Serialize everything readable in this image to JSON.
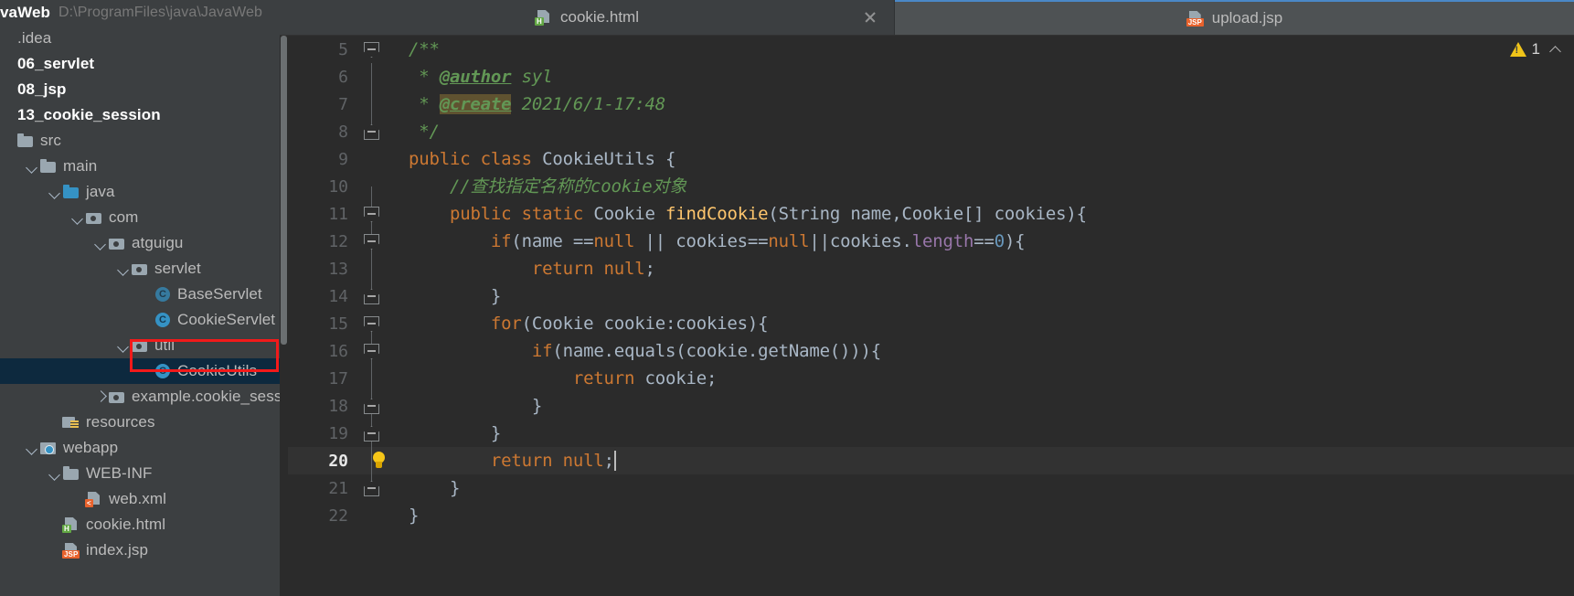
{
  "sidebar": {
    "project_header": {
      "name": "vaWeb",
      "path": "D:\\ProgramFiles\\java\\JavaWeb"
    },
    "items": [
      {
        "label": ".idea",
        "indent": 0,
        "twisty": "",
        "icon": "",
        "style": "plain",
        "selected": false
      },
      {
        "label": "06_servlet",
        "indent": 0,
        "twisty": "",
        "icon": "",
        "style": "bold",
        "selected": false
      },
      {
        "label": "08_jsp",
        "indent": 0,
        "twisty": "",
        "icon": "",
        "style": "bold",
        "selected": false
      },
      {
        "label": "13_cookie_session",
        "indent": 0,
        "twisty": "",
        "icon": "",
        "style": "bold",
        "selected": false
      },
      {
        "label": "src",
        "indent": 0,
        "twisty": "",
        "icon": "folder",
        "style": "plain",
        "selected": false
      },
      {
        "label": "main",
        "indent": 1,
        "twisty": "down",
        "icon": "folder",
        "style": "plain",
        "selected": false
      },
      {
        "label": "java",
        "indent": 2,
        "twisty": "down",
        "icon": "folder-src",
        "style": "plain",
        "selected": false
      },
      {
        "label": "com",
        "indent": 3,
        "twisty": "down",
        "icon": "pkg",
        "style": "plain",
        "selected": false
      },
      {
        "label": "atguigu",
        "indent": 4,
        "twisty": "down",
        "icon": "pkg",
        "style": "plain",
        "selected": false
      },
      {
        "label": "servlet",
        "indent": 5,
        "twisty": "down",
        "icon": "pkg",
        "style": "plain",
        "selected": false
      },
      {
        "label": "BaseServlet",
        "indent": 6,
        "twisty": "",
        "icon": "class-abs",
        "style": "plain",
        "selected": false
      },
      {
        "label": "CookieServlet",
        "indent": 6,
        "twisty": "",
        "icon": "class",
        "style": "plain",
        "selected": false
      },
      {
        "label": "util",
        "indent": 5,
        "twisty": "down",
        "icon": "pkg",
        "style": "plain",
        "selected": false
      },
      {
        "label": "CookieUtils",
        "indent": 6,
        "twisty": "",
        "icon": "class",
        "style": "plain",
        "selected": true
      },
      {
        "label": "example.cookie_session",
        "indent": 4,
        "twisty": "right",
        "icon": "pkg",
        "style": "plain",
        "selected": false
      },
      {
        "label": "resources",
        "indent": 2,
        "twisty": "",
        "icon": "res",
        "style": "plain",
        "selected": false
      },
      {
        "label": "webapp",
        "indent": 1,
        "twisty": "down",
        "icon": "web",
        "style": "plain",
        "selected": false
      },
      {
        "label": "WEB-INF",
        "indent": 2,
        "twisty": "down",
        "icon": "folder",
        "style": "plain",
        "selected": false
      },
      {
        "label": "web.xml",
        "indent": 3,
        "twisty": "",
        "icon": "file-xml",
        "style": "plain",
        "selected": false
      },
      {
        "label": "cookie.html",
        "indent": 2,
        "twisty": "",
        "icon": "file-h",
        "style": "plain",
        "selected": false
      },
      {
        "label": "index.jsp",
        "indent": 2,
        "twisty": "",
        "icon": "file-jsp",
        "style": "plain",
        "selected": false
      }
    ],
    "annotation": {
      "shape": "rectangle",
      "color": "#f21a1a",
      "targets": "CookieUtils"
    }
  },
  "editor": {
    "tabs": [
      {
        "label": "cookie.html",
        "icon": "html-file-icon",
        "active": false,
        "closable": true
      },
      {
        "label": "upload.jsp",
        "icon": "jsp-file-icon",
        "active": true,
        "closable": false
      }
    ],
    "inspection": {
      "warning_count": "1",
      "icon": "warning-triangle-icon"
    },
    "cursor_line": "20",
    "lines": [
      {
        "n": "5",
        "fold": "open",
        "foldline": "",
        "bulb": false,
        "indent_guides": [],
        "tokens": [
          {
            "t": "/**",
            "c": "doc"
          }
        ]
      },
      {
        "n": "6",
        "fold": "",
        "foldline": "full",
        "bulb": false,
        "indent_guides": [],
        "tokens": [
          {
            "t": " * ",
            "c": "doc"
          },
          {
            "t": "@author",
            "c": "tag"
          },
          {
            "t": " syl",
            "c": "doc"
          }
        ]
      },
      {
        "n": "7",
        "fold": "",
        "foldline": "full",
        "bulb": false,
        "indent_guides": [],
        "tokens": [
          {
            "t": " * ",
            "c": "doc"
          },
          {
            "t": "@create",
            "c": "tagH"
          },
          {
            "t": " 2021/6/1-17:48",
            "c": "doc"
          }
        ]
      },
      {
        "n": "8",
        "fold": "close",
        "foldline": "half-top",
        "bulb": false,
        "indent_guides": [],
        "tokens": [
          {
            "t": " */",
            "c": "doc"
          }
        ]
      },
      {
        "n": "9",
        "fold": "",
        "foldline": "",
        "bulb": false,
        "indent_guides": [],
        "tokens": [
          {
            "t": "public class ",
            "c": "kw"
          },
          {
            "t": "CookieUtils {",
            "c": "cls"
          }
        ]
      },
      {
        "n": "10",
        "fold": "",
        "foldline": "half-bot",
        "bulb": false,
        "indent_guides": [],
        "tokens": [
          {
            "t": "    //查找指定名称的cookie对象",
            "c": "cmt"
          }
        ]
      },
      {
        "n": "11",
        "fold": "open",
        "foldline": "full",
        "bulb": false,
        "indent_guides": [],
        "tokens": [
          {
            "t": "    ",
            "c": "pln"
          },
          {
            "t": "public static ",
            "c": "kw"
          },
          {
            "t": "Cookie ",
            "c": "cls"
          },
          {
            "t": "findCookie",
            "c": "mtd"
          },
          {
            "t": "(String name,Cookie[] cookies){",
            "c": "cls"
          }
        ]
      },
      {
        "n": "12",
        "fold": "open",
        "foldline": "full",
        "bulb": false,
        "indent_guides": [],
        "tokens": [
          {
            "t": "        ",
            "c": "pln"
          },
          {
            "t": "if",
            "c": "kw"
          },
          {
            "t": "(name ==",
            "c": "pln"
          },
          {
            "t": "null",
            "c": "kw"
          },
          {
            "t": " || cookies==",
            "c": "pln"
          },
          {
            "t": "null",
            "c": "kw"
          },
          {
            "t": "||cookies.",
            "c": "pln"
          },
          {
            "t": "length",
            "c": "fld"
          },
          {
            "t": "==",
            "c": "pln"
          },
          {
            "t": "0",
            "c": "num"
          },
          {
            "t": "){",
            "c": "pln"
          }
        ]
      },
      {
        "n": "13",
        "fold": "",
        "foldline": "full",
        "bulb": false,
        "indent_guides": [],
        "tokens": [
          {
            "t": "            ",
            "c": "pln"
          },
          {
            "t": "return null",
            "c": "kw"
          },
          {
            "t": ";",
            "c": "pln"
          }
        ]
      },
      {
        "n": "14",
        "fold": "close",
        "foldline": "half-top",
        "bulb": false,
        "indent_guides": [],
        "tokens": [
          {
            "t": "        }",
            "c": "pln"
          }
        ]
      },
      {
        "n": "15",
        "fold": "open",
        "foldline": "half-bot",
        "bulb": false,
        "indent_guides": [],
        "tokens": [
          {
            "t": "        ",
            "c": "pln"
          },
          {
            "t": "for",
            "c": "kw"
          },
          {
            "t": "(Cookie cookie:cookies){",
            "c": "pln"
          }
        ]
      },
      {
        "n": "16",
        "fold": "open",
        "foldline": "full",
        "bulb": false,
        "indent_guides": [],
        "tokens": [
          {
            "t": "            ",
            "c": "pln"
          },
          {
            "t": "if",
            "c": "kw"
          },
          {
            "t": "(name.equals(cookie.getName())){",
            "c": "pln"
          }
        ]
      },
      {
        "n": "17",
        "fold": "",
        "foldline": "full",
        "bulb": false,
        "indent_guides": [],
        "tokens": [
          {
            "t": "                ",
            "c": "pln"
          },
          {
            "t": "return",
            "c": "kw"
          },
          {
            "t": " cookie;",
            "c": "pln"
          }
        ]
      },
      {
        "n": "18",
        "fold": "close",
        "foldline": "full",
        "bulb": false,
        "indent_guides": [],
        "tokens": [
          {
            "t": "            }",
            "c": "pln"
          }
        ]
      },
      {
        "n": "19",
        "fold": "close",
        "foldline": "full",
        "bulb": false,
        "indent_guides": [],
        "tokens": [
          {
            "t": "        }",
            "c": "pln"
          }
        ]
      },
      {
        "n": "20",
        "fold": "",
        "foldline": "full",
        "bulb": true,
        "indent_guides": [],
        "tokens": [
          {
            "t": "        ",
            "c": "pln"
          },
          {
            "t": "return null",
            "c": "kw"
          },
          {
            "t": ";",
            "c": "pln"
          }
        ],
        "caret": true
      },
      {
        "n": "21",
        "fold": "close",
        "foldline": "half-top",
        "bulb": false,
        "indent_guides": [],
        "tokens": [
          {
            "t": "    }",
            "c": "pln"
          }
        ]
      },
      {
        "n": "22",
        "fold": "",
        "foldline": "",
        "bulb": false,
        "indent_guides": [],
        "tokens": [
          {
            "t": "}",
            "c": "pln"
          }
        ]
      }
    ]
  },
  "colors": {
    "ide_chrome": "#3c3f41",
    "editor_bg": "#2b2b2b",
    "selection_bg": "#0d293e",
    "annotation_red": "#f21a1a",
    "accent_blue": "#4a88c7",
    "keyword_orange": "#cc7832",
    "comment_green": "#629755",
    "method_yellow": "#ffc66d",
    "field_purple": "#9876aa",
    "number_blue": "#6897bb",
    "warning_yellow": "#f0c419"
  }
}
